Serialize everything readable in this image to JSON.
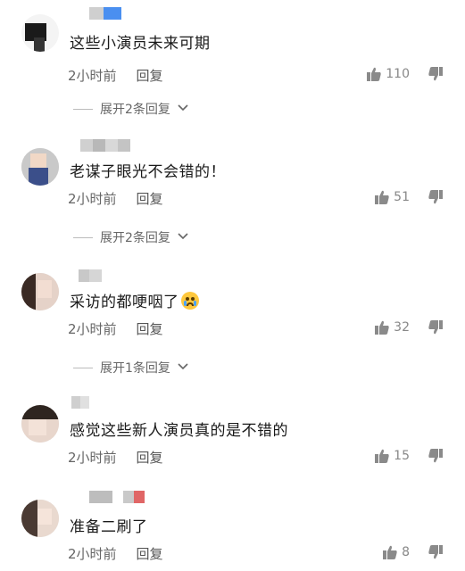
{
  "icons": {
    "like": "thumbs-up-icon",
    "dislike": "thumbs-down-icon",
    "expand": "chevron-down-icon",
    "emoji": "crying-face-emoji"
  },
  "colors": {
    "accent_blue": "#4a8ff0",
    "muted_text": "#666666",
    "icon_gray": "#8a8a8a"
  },
  "comments": [
    {
      "text": "这些小演员未来可期",
      "time": "2小时前",
      "reply": "回复",
      "likes": "110",
      "expand": "展开2条回复"
    },
    {
      "text": "老谋子眼光不会错的！",
      "time": "2小时前",
      "reply": "回复",
      "likes": "51",
      "expand": "展开2条回复"
    },
    {
      "text": "采访的都哽咽了",
      "time": "2小时前",
      "reply": "回复",
      "likes": "32",
      "expand": "展开1条回复"
    },
    {
      "text": "感觉这些新人演员真的是不错的",
      "time": "2小时前",
      "reply": "回复",
      "likes": "15"
    },
    {
      "text": "准备二刷了",
      "time": "2小时前",
      "reply": "回复",
      "likes": "8"
    }
  ]
}
